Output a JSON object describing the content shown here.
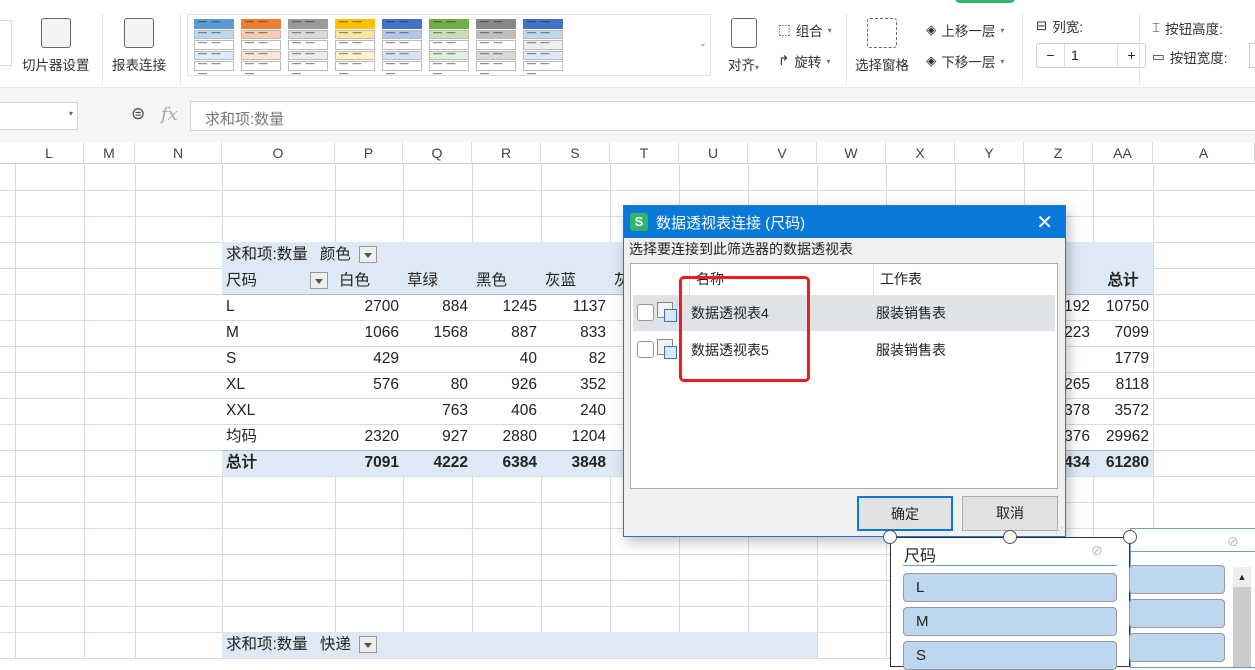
{
  "ribbon": {
    "slicer_settings": "切片器设置",
    "report_connections": "报表连接",
    "align": "对齐",
    "group": "组合",
    "rotate": "旋转",
    "selection_pane": "选择窗格",
    "bring_forward": "上移一层",
    "send_backward": "下移一层",
    "columns_label": "列宽:",
    "columns_value": "1",
    "minus": "−",
    "plus": "+",
    "button_height": "按钮高度:",
    "button_width": "按钮宽度:"
  },
  "formula_bar": {
    "fx": "fx",
    "content": "求和项:数量"
  },
  "columns": [
    "L",
    "M",
    "N",
    "O",
    "P",
    "Q",
    "R",
    "S",
    "T",
    "U",
    "V",
    "W",
    "X",
    "Y",
    "Z",
    "AA",
    "A"
  ],
  "pivot1": {
    "title": "求和项:数量",
    "col_field": "颜色",
    "row_field": "尺码",
    "col_headers": [
      "白色",
      "草绿",
      "黑色",
      "灰蓝",
      "灰"
    ],
    "total_header": "总计",
    "rows": [
      {
        "label": "L",
        "values": [
          "2700",
          "884",
          "1245",
          "1137"
        ],
        "partial": "192",
        "total": "10750"
      },
      {
        "label": "M",
        "values": [
          "1066",
          "1568",
          "887",
          "833"
        ],
        "partial": "223",
        "total": "7099"
      },
      {
        "label": "S",
        "values": [
          "429",
          "",
          "40",
          "82"
        ],
        "partial": "",
        "total": "1779"
      },
      {
        "label": "XL",
        "values": [
          "576",
          "80",
          "926",
          "352"
        ],
        "partial": "265",
        "total": "8118"
      },
      {
        "label": "XXL",
        "values": [
          "",
          "763",
          "406",
          "240"
        ],
        "partial": "378",
        "total": "3572"
      },
      {
        "label": "均码",
        "values": [
          "2320",
          "927",
          "2880",
          "1204"
        ],
        "partial": "376",
        "total": "29962"
      }
    ],
    "grand": {
      "label": "总计",
      "values": [
        "7091",
        "4222",
        "6384",
        "3848"
      ],
      "partial": "434",
      "total": "61280"
    }
  },
  "pivot2": {
    "title": "求和项:数量",
    "col_field": "快递"
  },
  "dialog": {
    "logo": "S",
    "title": "数据透视表连接 (尺码)",
    "close": "✕",
    "prompt": "选择要连接到此筛选器的数据透视表",
    "col_name": "名称",
    "col_sheet": "工作表",
    "rows": [
      {
        "name": "数据透视表4",
        "sheet": "服装销售表",
        "checked": false
      },
      {
        "name": "数据透视表5",
        "sheet": "服装销售表",
        "checked": false
      }
    ],
    "ok": "确定",
    "cancel": "取消"
  },
  "slicer": {
    "title": "尺码",
    "items": [
      "L",
      "M",
      "S"
    ]
  }
}
